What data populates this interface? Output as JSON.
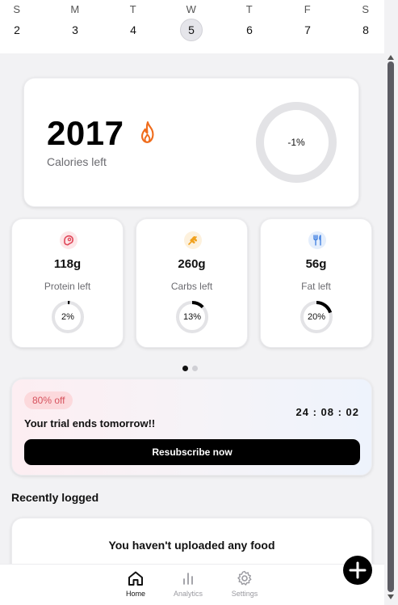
{
  "week": {
    "days": [
      {
        "name": "S",
        "date": "2"
      },
      {
        "name": "M",
        "date": "3"
      },
      {
        "name": "T",
        "date": "4"
      },
      {
        "name": "W",
        "date": "5",
        "selected": true
      },
      {
        "name": "T",
        "date": "6"
      },
      {
        "name": "F",
        "date": "7"
      },
      {
        "name": "S",
        "date": "8"
      }
    ]
  },
  "calories": {
    "value": "2017",
    "label": "Calories left",
    "ring_label": "-1%",
    "progress": 0,
    "flame_color": "#ef6c1c"
  },
  "macros": [
    {
      "value": "118g",
      "label": "Protein left",
      "pct_label": "2%",
      "progress": 0.02,
      "icon": "steak-icon",
      "icon_color": "#e0485a",
      "icon_bg": "#fde6e8"
    },
    {
      "value": "260g",
      "label": "Carbs left",
      "pct_label": "13%",
      "progress": 0.13,
      "icon": "wheat-icon",
      "icon_color": "#f0a11e",
      "icon_bg": "#fdf1dd"
    },
    {
      "value": "56g",
      "label": "Fat left",
      "pct_label": "20%",
      "progress": 0.2,
      "icon": "fork-knife-icon",
      "icon_color": "#3b7de0",
      "icon_bg": "#e4eefc"
    }
  ],
  "pager": {
    "active": 0,
    "count": 2
  },
  "trial": {
    "badge": "80% off",
    "message": "Your trial ends tomorrow!!",
    "timer": "24 : 08 : 02",
    "button": "Resubscribe now"
  },
  "recent": {
    "title": "Recently logged",
    "empty": "You haven't uploaded any food"
  },
  "nav": {
    "home": "Home",
    "analytics": "Analytics",
    "settings": "Settings",
    "active": "home"
  },
  "colors": {
    "ring_track": "#e3e3e6",
    "ring_fill": "#000000",
    "nav_inactive": "#9a9aa0"
  }
}
